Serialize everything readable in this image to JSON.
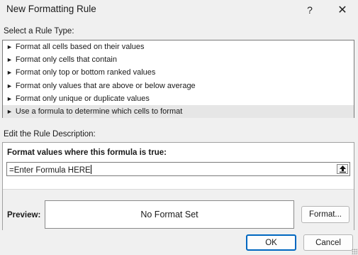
{
  "window": {
    "title": "New Formatting Rule",
    "help_label": "?",
    "close_label": "✕"
  },
  "rule_type": {
    "label": "Select a Rule Type:",
    "items": [
      {
        "label": "Format all cells based on their values"
      },
      {
        "label": "Format only cells that contain"
      },
      {
        "label": "Format only top or bottom ranked values"
      },
      {
        "label": "Format only values that are above or below average"
      },
      {
        "label": "Format only unique or duplicate values"
      },
      {
        "label": "Use a formula to determine which cells to format"
      }
    ],
    "selected_index": 5
  },
  "description": {
    "label": "Edit the Rule Description:",
    "heading": "Format values where this formula is true:",
    "formula_value": "=Enter Formula HERE",
    "collapse_icon": "upload-arrow-icon"
  },
  "preview": {
    "label": "Preview:",
    "text": "No Format Set",
    "format_button": "Format..."
  },
  "footer": {
    "ok_label": "OK",
    "cancel_label": "Cancel"
  },
  "colors": {
    "accent": "#0067c0",
    "dialog_bg": "#f0f0f0",
    "selected_row": "#e6e6e6"
  }
}
